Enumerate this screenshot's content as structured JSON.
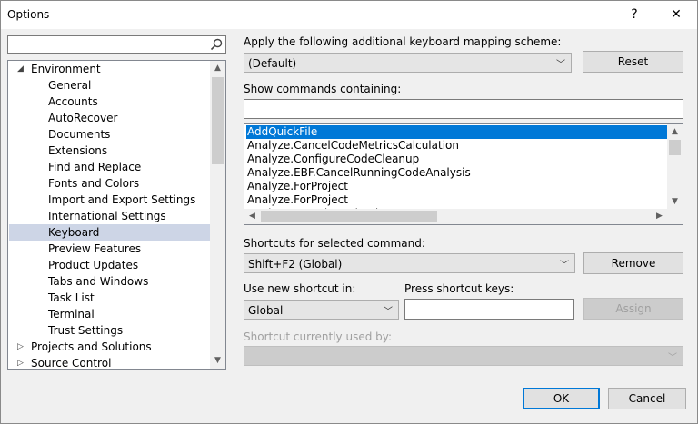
{
  "window": {
    "title": "Options",
    "help_glyph": "?",
    "close_glyph": "✕"
  },
  "search": {
    "placeholder": "",
    "value": ""
  },
  "tree": {
    "items": [
      {
        "label": "Environment",
        "level": 0,
        "toggle": "◢"
      },
      {
        "label": "General",
        "level": 1
      },
      {
        "label": "Accounts",
        "level": 1
      },
      {
        "label": "AutoRecover",
        "level": 1
      },
      {
        "label": "Documents",
        "level": 1
      },
      {
        "label": "Extensions",
        "level": 1
      },
      {
        "label": "Find and Replace",
        "level": 1
      },
      {
        "label": "Fonts and Colors",
        "level": 1
      },
      {
        "label": "Import and Export Settings",
        "level": 1
      },
      {
        "label": "International Settings",
        "level": 1
      },
      {
        "label": "Keyboard",
        "level": 1,
        "selected": true
      },
      {
        "label": "Preview Features",
        "level": 1
      },
      {
        "label": "Product Updates",
        "level": 1
      },
      {
        "label": "Tabs and Windows",
        "level": 1
      },
      {
        "label": "Task List",
        "level": 1
      },
      {
        "label": "Terminal",
        "level": 1
      },
      {
        "label": "Trust Settings",
        "level": 1
      },
      {
        "label": "Projects and Solutions",
        "level": 0,
        "toggle": "▷"
      },
      {
        "label": "Source Control",
        "level": 0,
        "toggle": "▷"
      }
    ]
  },
  "mapping": {
    "label": "Apply the following additional keyboard mapping scheme:",
    "value": "(Default)",
    "reset_label": "Reset"
  },
  "show_commands": {
    "label": "Show commands containing:",
    "value": "",
    "items": [
      {
        "label": "AddQuickFile",
        "selected": true
      },
      {
        "label": "Analyze.CancelCodeMetricsCalculation"
      },
      {
        "label": "Analyze.ConfigureCodeCleanup"
      },
      {
        "label": "Analyze.EBF.CancelRunningCodeAnalysis"
      },
      {
        "label": "Analyze.ForProject"
      },
      {
        "label": "Analyze.ForProject"
      },
      {
        "label": "Analyze.ForSelectedProjects"
      }
    ]
  },
  "shortcuts": {
    "label": "Shortcuts for selected command:",
    "value": "Shift+F2 (Global)",
    "remove_label": "Remove"
  },
  "new_shortcut": {
    "use_label": "Use new shortcut in:",
    "use_value": "Global",
    "press_label": "Press shortcut keys:",
    "press_value": "",
    "assign_label": "Assign"
  },
  "currently_used": {
    "label": "Shortcut currently used by:",
    "value": ""
  },
  "footer": {
    "ok_label": "OK",
    "cancel_label": "Cancel"
  },
  "colors": {
    "accent": "#0078d7",
    "tree_selected": "#cdd5e6"
  }
}
